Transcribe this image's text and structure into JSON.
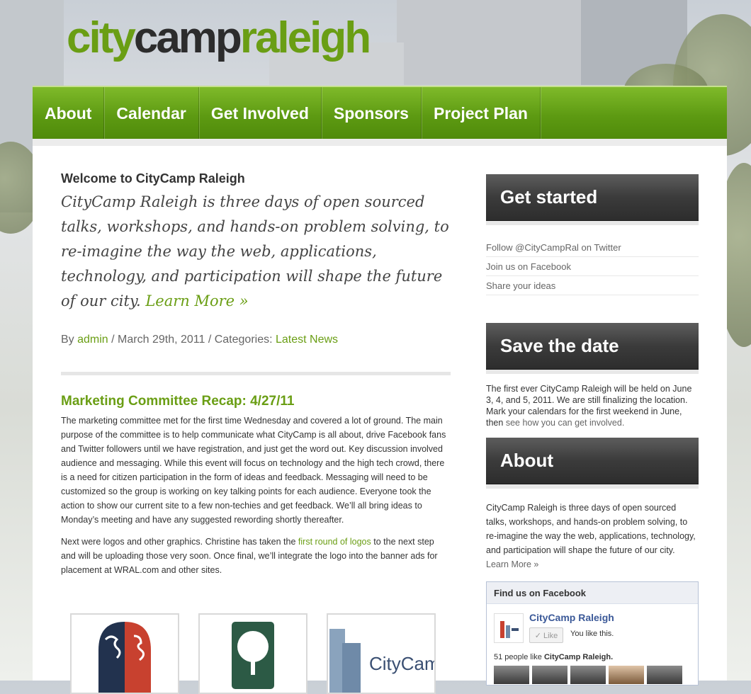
{
  "logo": {
    "part1": "city",
    "part2": "camp",
    "part3": "raleigh"
  },
  "nav": {
    "items": [
      "About",
      "Calendar",
      "Get Involved",
      "Sponsors",
      "Project Plan"
    ]
  },
  "post": {
    "welcome_title": "Welcome to CityCamp Raleigh",
    "welcome_text": "CityCamp Raleigh is three days of open sourced talks, workshops, and hands-on problem solving, to re-imagine the way the web, applications, technology, and participation will shape the future of our city.",
    "learn_more": "Learn More »",
    "meta_by": "By",
    "meta_author": "admin",
    "meta_date": "/ March 29th, 2011 / Categories:",
    "meta_category": "Latest News"
  },
  "article": {
    "title": "Marketing Committee Recap: 4/27/11",
    "p1": "The marketing committee met for the first time Wednesday and covered a lot of ground. The main purpose of the committee is to help communicate what CityCamp is all about, drive Facebook fans and Twitter followers until we have registration, and just get the word out. Key discussion involved audience and messaging. While this event will focus on technology and the high tech crowd, there is a need for citizen participation in the form of ideas and feedback. Messaging will need to be customized so the group is working on key talking points for each audience. Everyone took the action to show our current site to a few non-techies and get feedback. We’ll all bring ideas to Monday’s meeting and have any suggested rewording shortly thereafter.",
    "p2_before": "Next were logos and other graphics. Christine has taken the",
    "p2_link": "first round of logos",
    "p2_after": "to the next step and will be uploading those very soon. Once final, we’ll integrate the logo into the banner ads for placement at WRAL.com and other sites.",
    "thumb3_text": "CityCamp Raleigh"
  },
  "sidebar": {
    "get_started": {
      "title": "Get started",
      "links": [
        "Follow @CityCampRal on Twitter",
        "Join us on Facebook",
        "Share your ideas"
      ]
    },
    "save_date": {
      "title": "Save the date",
      "text": "The first ever CityCamp Raleigh will be held on June 3, 4, and 5, 2011. We are still finalizing the location. Mark your calendars for the first weekend in June, then",
      "link": "see how you can get involved."
    },
    "about": {
      "title": "About",
      "text": "CityCamp Raleigh is three days of open sourced talks, workshops, and hands-on problem solving, to re-imagine the way the web, applications, technology, and participation will shape the future of our city.",
      "link": "Learn More »"
    }
  },
  "facebook": {
    "title": "Find us on Facebook",
    "page_name": "CityCamp Raleigh",
    "like_label": "✓ Like",
    "you_like": "You like this.",
    "count_prefix": "51 people like",
    "count_name": "CityCamp Raleigh."
  },
  "colors": {
    "accent": "#6a9e14",
    "nav_green": "#5d9a12",
    "sidebar_dark": "#3b3b3b",
    "fb_blue": "#3b5998"
  }
}
